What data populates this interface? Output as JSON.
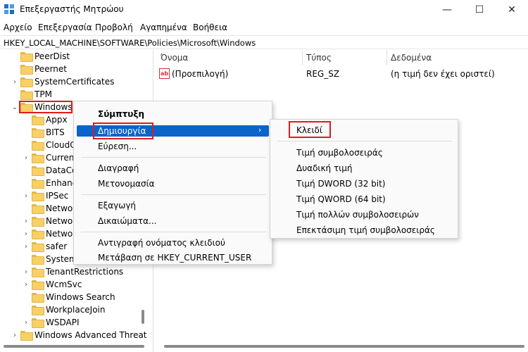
{
  "window": {
    "title": "Επεξεργαστής Μητρώου",
    "minimize_glyph": "—",
    "maximize_glyph": "☐",
    "close_glyph": "✕"
  },
  "menu": [
    "Αρχείο",
    "Επεξεργασία",
    "Προβολή",
    "Αγαπημένα",
    "Βοήθεια"
  ],
  "address": "HKEY_LOCAL_MACHINE\\SOFTWARE\\Policies\\Microsoft\\Windows",
  "tree": {
    "items": [
      {
        "label": "PeerDist",
        "expandable": false
      },
      {
        "label": "Peernet",
        "expandable": false
      },
      {
        "label": "SystemCertificates",
        "expandable": true
      },
      {
        "label": "TPM",
        "expandable": false
      },
      {
        "label": "Windows",
        "expandable": true,
        "expanded": true,
        "selected": true
      },
      {
        "label": "Appx",
        "expandable": false
      },
      {
        "label": "BITS",
        "expandable": false
      },
      {
        "label": "CloudC",
        "expandable": false
      },
      {
        "label": "Curren",
        "expandable": true
      },
      {
        "label": "DataCo",
        "expandable": false
      },
      {
        "label": "Enhanc",
        "expandable": false
      },
      {
        "label": "IPSec",
        "expandable": true
      },
      {
        "label": "Netwo",
        "expandable": false
      },
      {
        "label": "Netwo",
        "expandable": true
      },
      {
        "label": "Netwo",
        "expandable": true
      },
      {
        "label": "safer",
        "expandable": true
      },
      {
        "label": "System",
        "expandable": false
      },
      {
        "label": "TenantRestrictions",
        "expandable": true
      },
      {
        "label": "WcmSvc",
        "expandable": true
      },
      {
        "label": "Windows Search",
        "expandable": false
      },
      {
        "label": "WorkplaceJoin",
        "expandable": false
      },
      {
        "label": "WSDAPI",
        "expandable": true
      },
      {
        "label": "Windows Advanced Threat P",
        "expandable": true
      }
    ]
  },
  "list": {
    "columns": [
      "Όνομα",
      "Τύπος",
      "Δεδομένα"
    ],
    "rows": [
      {
        "name": "(Προεπιλογή)",
        "type": "REG_SZ",
        "data": "(η τιμή δεν έχει οριστεί)",
        "icon": "string-value-icon"
      }
    ]
  },
  "context_menu": {
    "collapse": "Σύμπτυξη",
    "new": "Δημιουργία",
    "find": "Εύρεση...",
    "delete": "Διαγραφή",
    "rename": "Μετονομασία",
    "export": "Εξαγωγή",
    "permissions": "Δικαιώματα...",
    "copy_key_name": "Αντιγραφή ονόματος κλειδιού",
    "goto_hkcu": "Μετάβαση σε HKEY_CURRENT_USER"
  },
  "submenu": {
    "key": "Κλειδί",
    "string_value": "Τιμή συμβολοσειράς",
    "binary_value": "Δυαδική τιμή",
    "dword_value": "Τιμή DWORD (32 bit)",
    "qword_value": "Τιμή QWORD (64 bit)",
    "multi_string_value": "Τιμή πολλών συμβολοσειρών",
    "expandable_string_value": "Επεκτάσιμη τιμή συμβολοσειράς"
  },
  "colors": {
    "highlight": "#0a64c9",
    "annotation_red": "#e01b1b",
    "folder": "#f8d066"
  }
}
